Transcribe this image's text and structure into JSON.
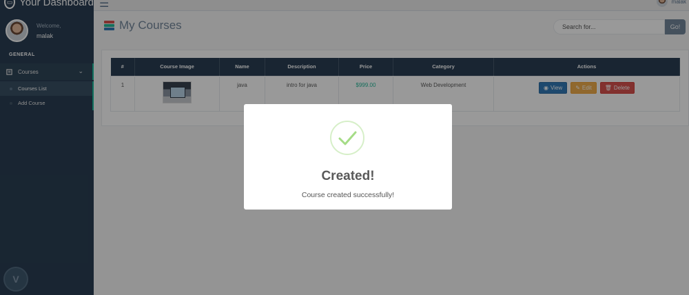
{
  "sidebar": {
    "brand_title": "Your Dashboard",
    "welcome": "Welcome,",
    "username": "malak",
    "section_label": "GENERAL",
    "menu": {
      "label": "Courses",
      "icon": "book-icon",
      "items": [
        {
          "label": "Courses List",
          "active": true
        },
        {
          "label": "Add Course",
          "active": false
        }
      ]
    }
  },
  "topnav": {
    "user_name": "malak"
  },
  "header": {
    "title": "My Courses",
    "search_placeholder": "Search for...",
    "search_button": "Go!"
  },
  "table": {
    "columns": [
      "#",
      "Course Image",
      "Name",
      "Description",
      "Price",
      "Category",
      "Actions"
    ],
    "rows": [
      {
        "num": "1",
        "name": "java",
        "description": "intro for java",
        "price": "$999.00",
        "category": "Web Development"
      }
    ],
    "actions": {
      "view": "View",
      "edit": "Edit",
      "delete": "Delete"
    }
  },
  "modal": {
    "title": "Created!",
    "text": "Course created successfully!",
    "icon": "success-check-icon"
  },
  "colors": {
    "sidebar_bg": "#2a3f54",
    "accent": "#1abb9c",
    "price": "#26b99a",
    "view": "#337ab7",
    "edit": "#f0ad4e",
    "delete": "#d9534f",
    "success": "#a5dc86"
  }
}
